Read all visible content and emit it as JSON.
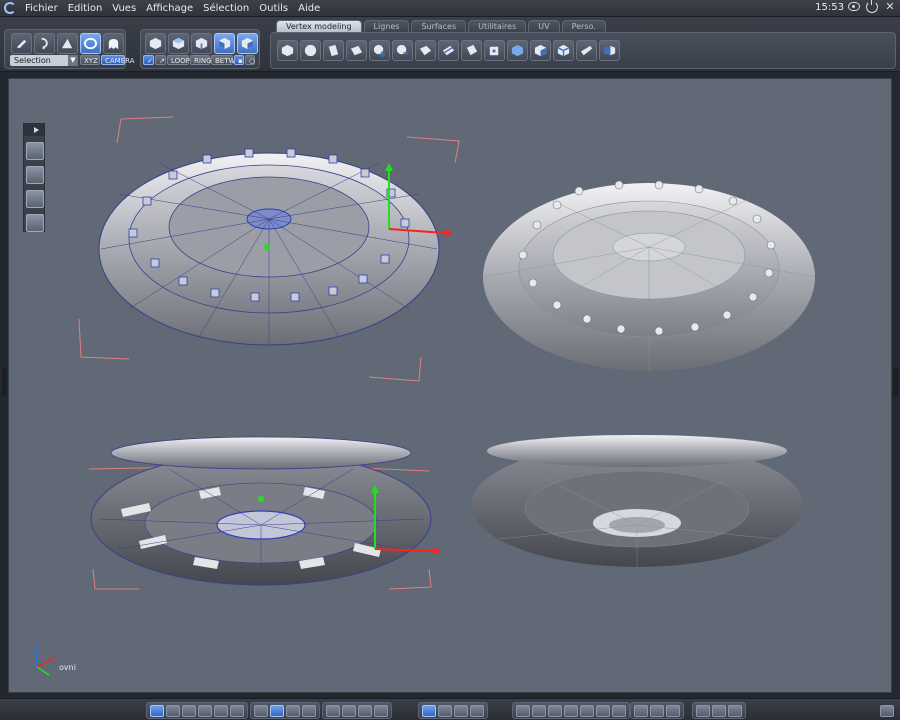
{
  "menubar": {
    "items": [
      "Fichier",
      "Edition",
      "Vues",
      "Affichage",
      "Sélection",
      "Outils",
      "Aide"
    ],
    "clock": "15:53"
  },
  "toolbar": {
    "selection_mode": "Selection",
    "xyz_label": "XYZ",
    "camera_label": "CAMERA",
    "loop_label": "LOOP",
    "ring_label": "RING",
    "betw_label": "BETW",
    "tabs": [
      "Vertex modeling",
      "Lignes",
      "Surfaces",
      "Utilitaires",
      "UV",
      "Perso."
    ],
    "active_tab": "Vertex modeling"
  },
  "viewport": {
    "object_name": "ovni",
    "axis_colors": {
      "x": "#ff2020",
      "y": "#20e020",
      "z": "#2070ff"
    }
  },
  "colors": {
    "accent": "#4a82e0",
    "background": "#616876"
  }
}
